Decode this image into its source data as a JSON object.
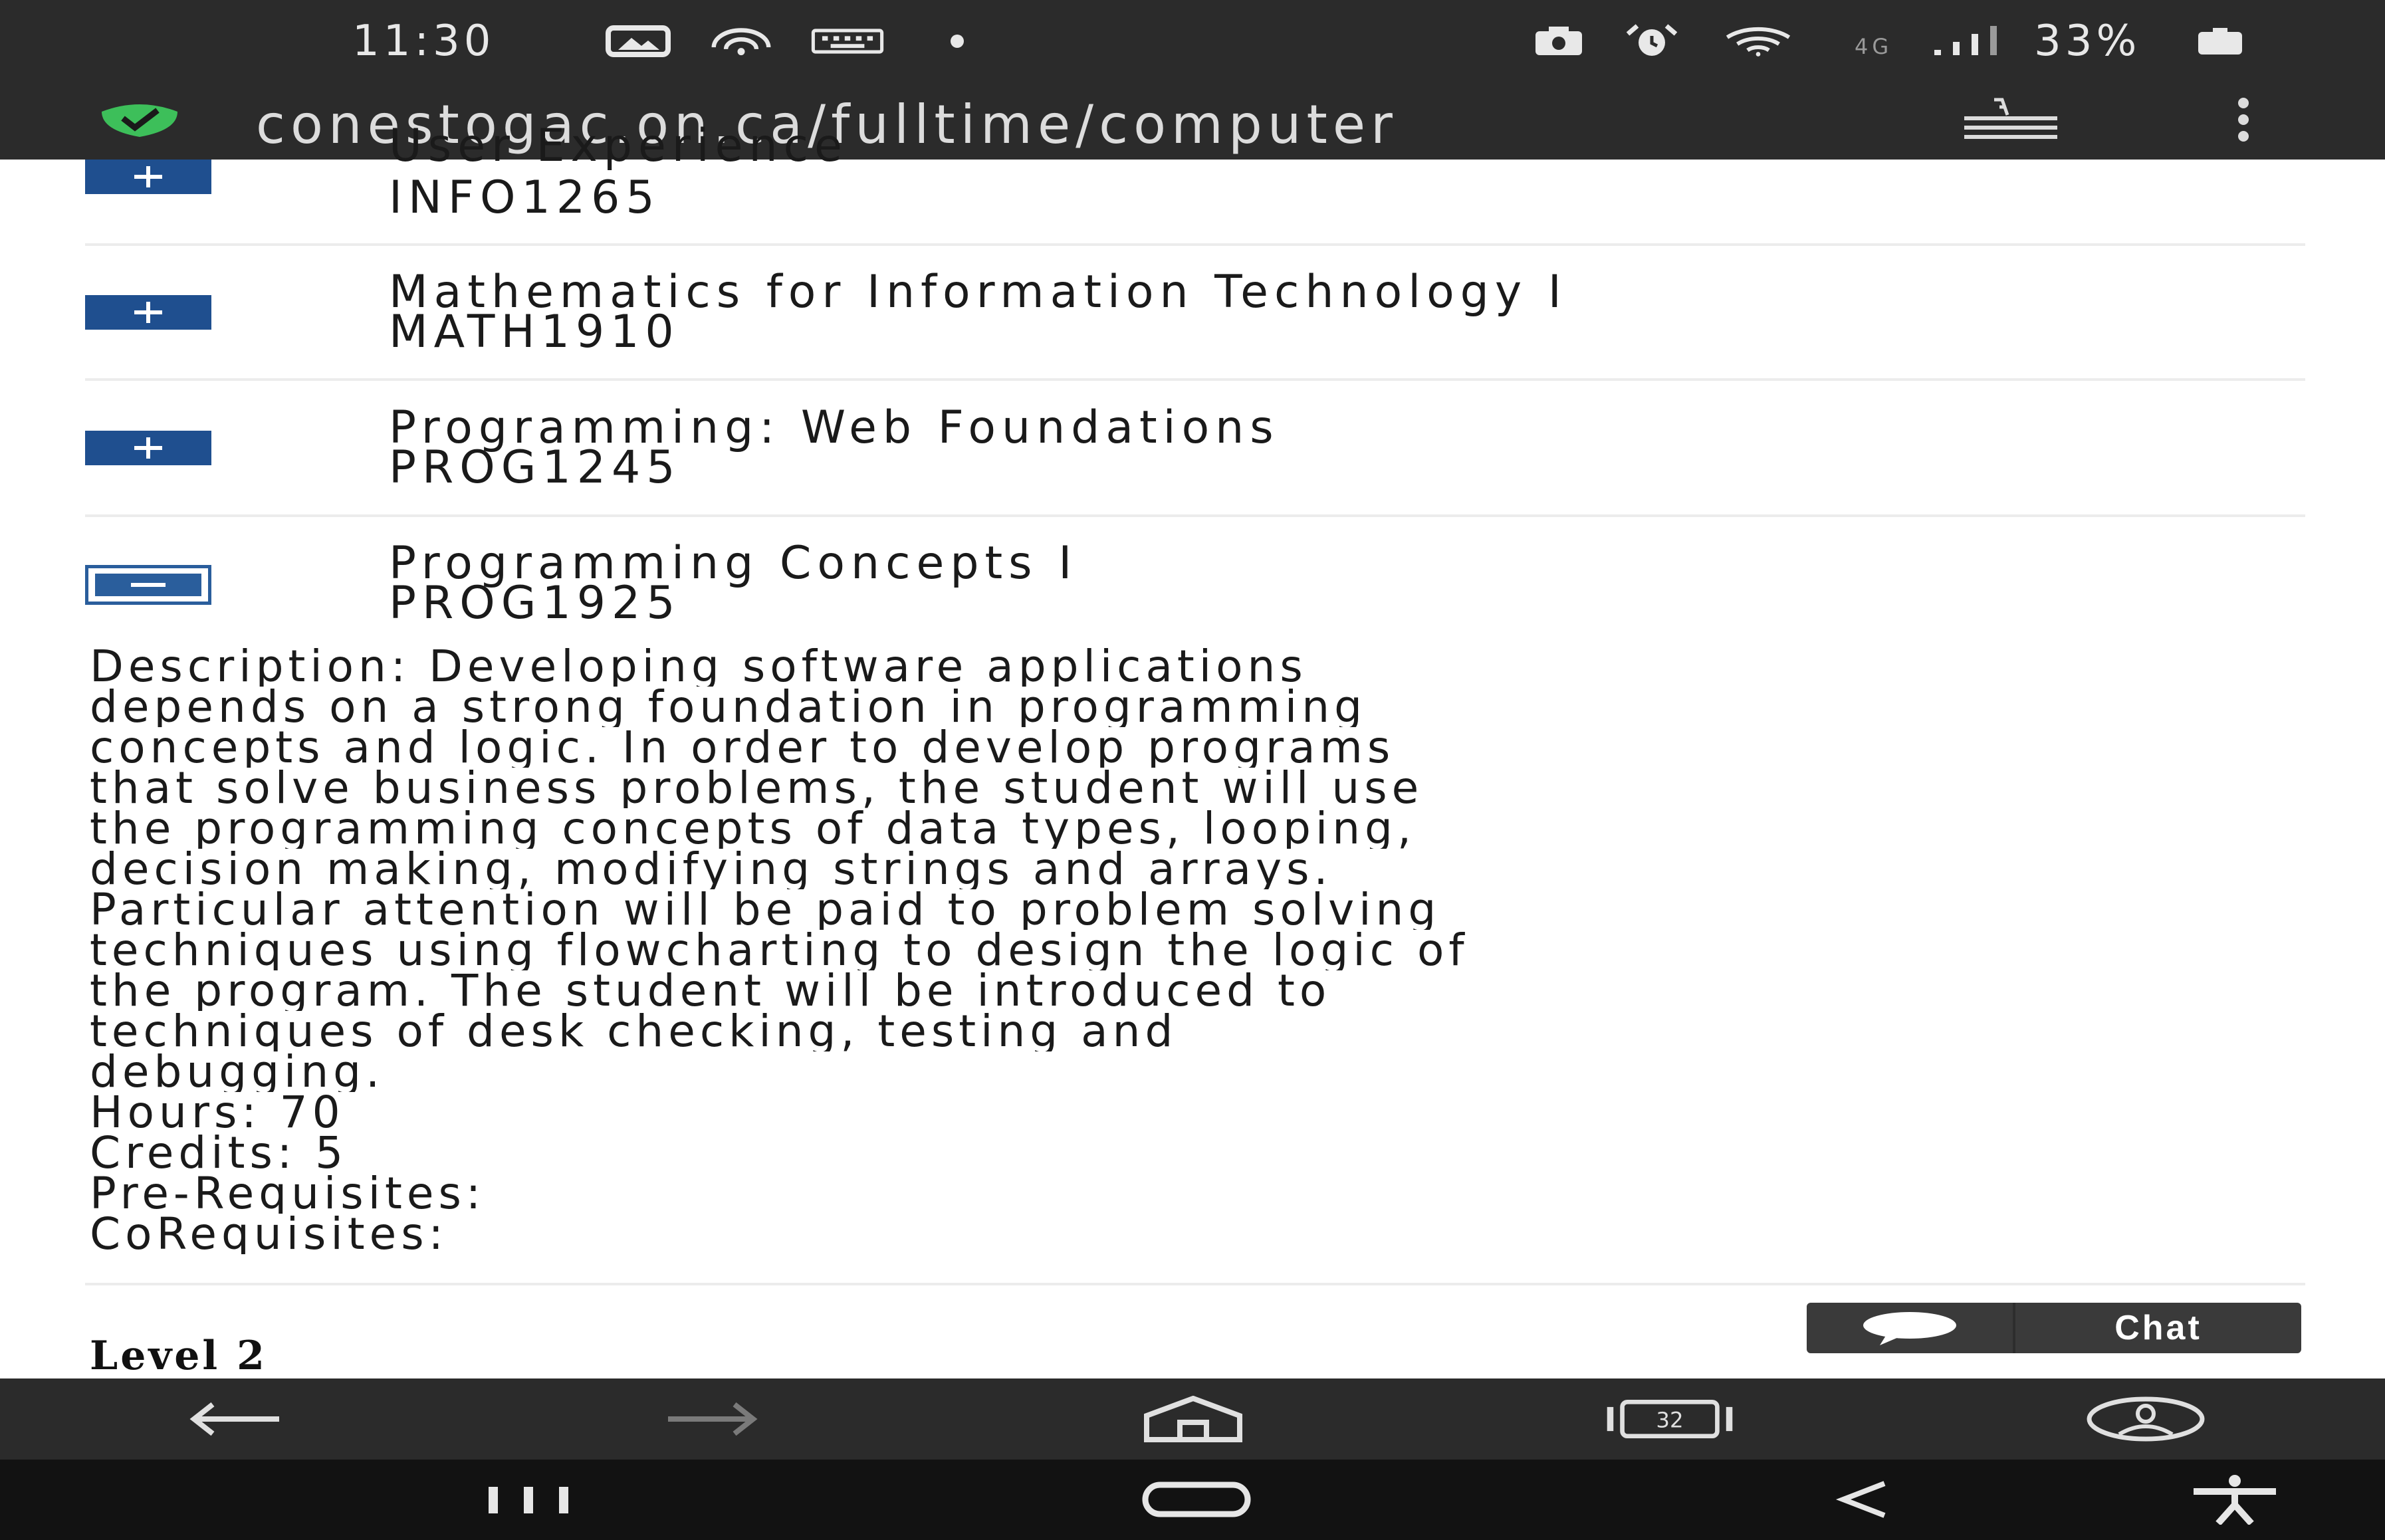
{
  "status_bar": {
    "time": "11:30",
    "battery": "33%",
    "network": "4G",
    "icons": [
      "gallery-icon",
      "hotspot-icon",
      "keyboard-icon",
      "dot-icon",
      "camera-icon",
      "alarm-icon",
      "wifi-icon",
      "signal-icon",
      "battery-icon"
    ]
  },
  "address_bar": {
    "url": "conestogac.on.ca/fulltime/computer",
    "icons": [
      "shield-check-icon",
      "reader-mode-icon",
      "more-vert-icon"
    ]
  },
  "courses": [
    {
      "title": "User Experience",
      "code": "INFO1265",
      "expanded": false
    },
    {
      "title": "Mathematics for Information Technology I",
      "code": "MATH1910",
      "expanded": false
    },
    {
      "title": "Programming: Web Foundations",
      "code": "PROG1245",
      "expanded": false
    },
    {
      "title": "Programming Concepts I",
      "code": "PROG1925",
      "expanded": true
    }
  ],
  "description_lines": [
    "Description: Developing software applications",
    "depends on a strong foundation in programming",
    "concepts and logic. In order to develop programs",
    "that solve business problems, the student will use",
    "the programming concepts of data types, looping,",
    "decision making, modifying strings and arrays.",
    "Particular attention will be paid to problem solving",
    "techniques using flowcharting to design the logic of",
    "the program. The student will be introduced to",
    "techniques of desk checking, testing and",
    "debugging."
  ],
  "details": {
    "hours": "Hours: 70",
    "credits": "Credits: 5",
    "prerequisites": "Pre-Requisites:",
    "corequisites": "CoRequisites:"
  },
  "level_heading": "Level 2",
  "chat": {
    "label": "Chat",
    "icon": "chat-bubble-icon"
  },
  "browser_toolbar": {
    "tab_count": "32",
    "icons": [
      "back-arrow-icon",
      "forward-arrow-icon",
      "home-icon",
      "tabs-icon",
      "account-icon"
    ]
  },
  "nav_bar": {
    "icons": [
      "recents-icon",
      "home-pill-icon",
      "back-icon",
      "accessibility-icon"
    ]
  },
  "colors": {
    "toggle_blue": "#1f4f8f",
    "chrome_dark": "#2b2b2b",
    "nav_black": "#121212",
    "shield_green": "#3dbf5a"
  }
}
